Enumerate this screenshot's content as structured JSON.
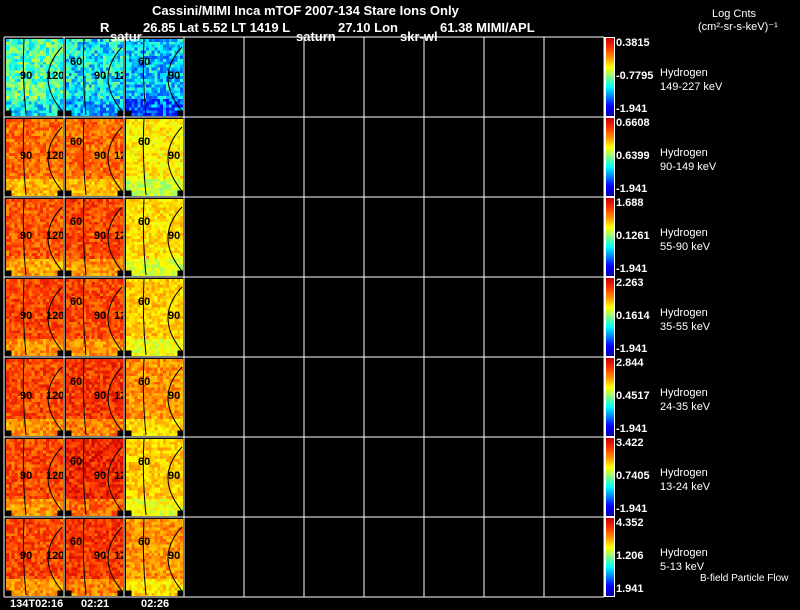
{
  "header": {
    "title": "Cassini/MIMI Inca mTOF  2007-134   Stare   Ions Only",
    "r_label": "R",
    "line2a": "26.85 Lat 5.52 LT 1419 L",
    "line2b": "27.10 Lon",
    "line2c": "61.38  MIMI/APL",
    "units_title": "Log Cnts",
    "units": "(cm²-sr-s-keV)⁻¹",
    "overlay_labels": [
      "satur",
      "saturn",
      "skr-wl"
    ]
  },
  "footer": {
    "time_labels": [
      "134T02:16",
      "02:21",
      "02:26"
    ],
    "note": "B-field Particle Flow"
  },
  "chart_data": {
    "type": "heatmap",
    "title": "Cassini/MIMI Inca mTOF 2007-134 Stare Ions Only",
    "columns": 10,
    "filled_columns": 3,
    "contour_labels": [
      [
        "90",
        "120"
      ],
      [
        "60",
        "90",
        "120"
      ],
      [
        "60",
        "90"
      ]
    ],
    "rows": [
      {
        "species": "Hydrogen",
        "energy": "149-227 keV",
        "max": "0.3815",
        "mid": "-0.7795",
        "min": "-1.941",
        "levels": [
          0.5,
          0.42,
          0.36
        ]
      },
      {
        "species": "Hydrogen",
        "energy": "90-149 keV",
        "max": "0.6608",
        "mid": "0.6399",
        "min": "-1.941",
        "levels": [
          0.84,
          0.84,
          0.7
        ]
      },
      {
        "species": "Hydrogen",
        "energy": "55-90 keV",
        "max": "1.688",
        "mid": "0.1261",
        "min": "-1.941",
        "levels": [
          0.86,
          0.88,
          0.72
        ]
      },
      {
        "species": "Hydrogen",
        "energy": "35-55 keV",
        "max": "2.263",
        "mid": "0.1614",
        "min": "-1.941",
        "levels": [
          0.88,
          0.88,
          0.74
        ]
      },
      {
        "species": "Hydrogen",
        "energy": "24-35 keV",
        "max": "2.844",
        "mid": "0.4517",
        "min": "-1.941",
        "levels": [
          0.88,
          0.9,
          0.8
        ]
      },
      {
        "species": "Hydrogen",
        "energy": "13-24 keV",
        "max": "3.422",
        "mid": "0.7405",
        "min": "-1.941",
        "levels": [
          0.88,
          0.92,
          0.74
        ]
      },
      {
        "species": "Hydrogen",
        "energy": "5-13 keV",
        "max": "4.352",
        "mid": "1.206",
        "min": "1.941",
        "levels": [
          0.88,
          0.9,
          0.8
        ]
      }
    ]
  }
}
